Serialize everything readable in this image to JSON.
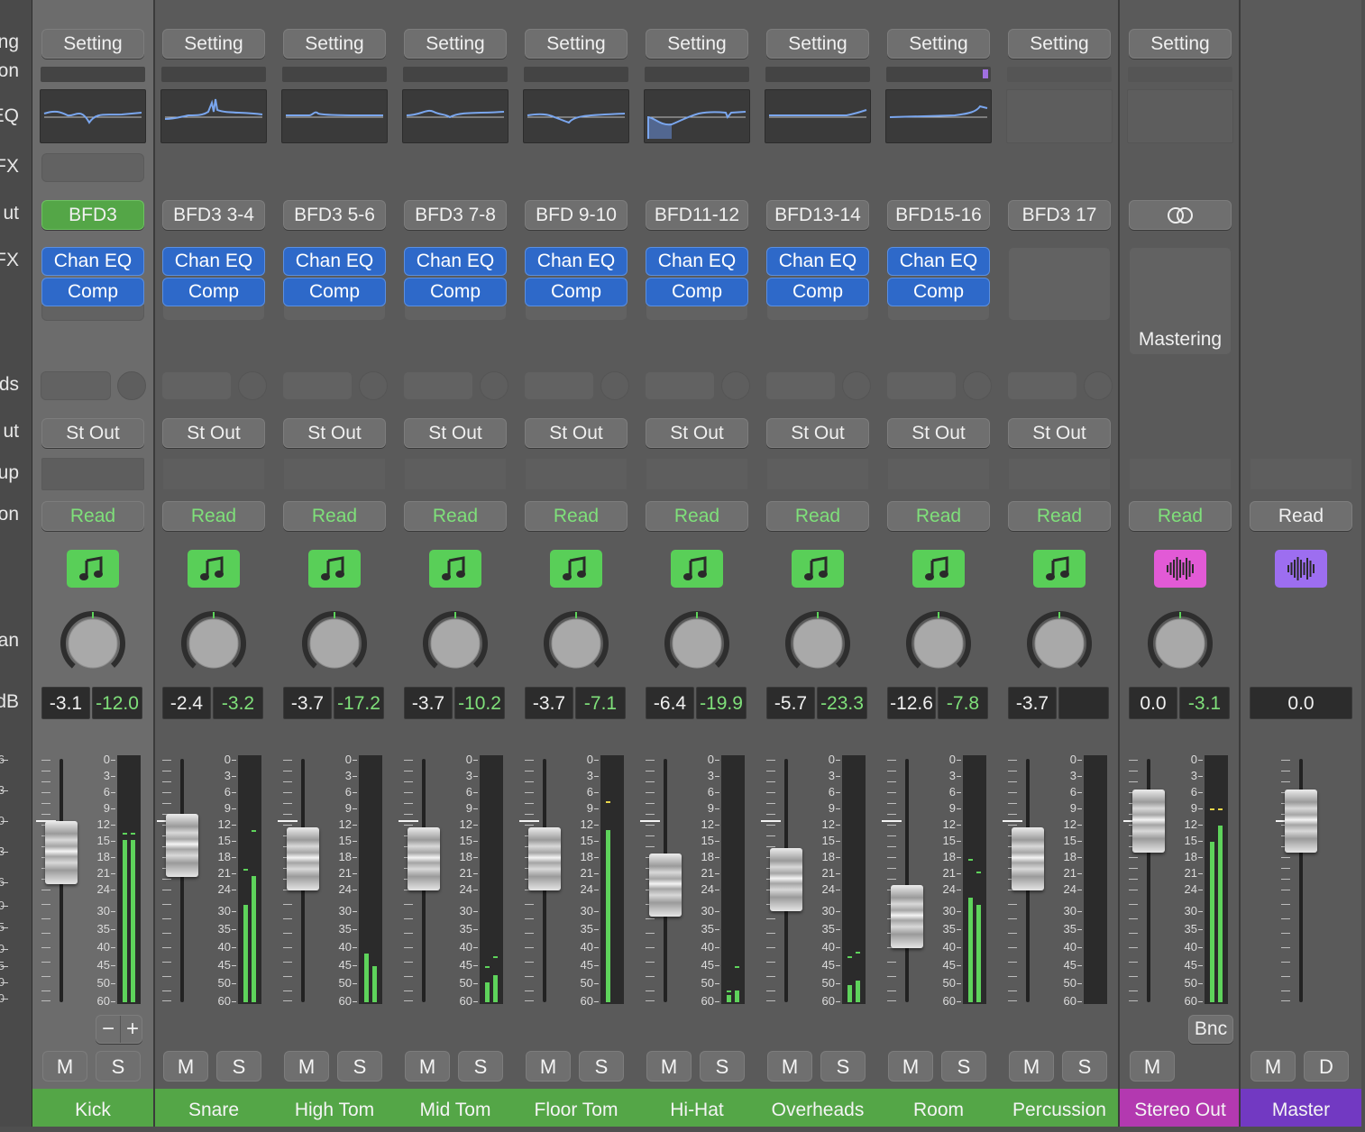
{
  "row_labels": [
    "ng",
    "on",
    "EQ",
    "FX",
    "ut",
    "FX",
    "ds",
    "ut",
    "up",
    "on",
    "an",
    "dB"
  ],
  "left_scale": [
    "6",
    "3",
    "0",
    "3",
    "6",
    "0",
    "5",
    "0",
    "5",
    "0",
    "0"
  ],
  "meter_scale": [
    "0",
    "3",
    "6",
    "9",
    "12",
    "15",
    "18",
    "21",
    "24",
    "30",
    "35",
    "40",
    "45",
    "50",
    "60"
  ],
  "colors": {
    "track_green": "#54a647",
    "stereo_magenta": "#b339b0",
    "master_purple": "#7239c2",
    "plugin_blue": "#2e69c9",
    "meter_green": "#5ed35b",
    "peak_yellow": "#e8d64a"
  },
  "channels": [
    {
      "name": "Kick",
      "setting": "Setting",
      "input": "BFD3",
      "input_active": true,
      "plugins": [
        "Chan EQ",
        "Comp"
      ],
      "output": "St Out",
      "automation": "Read",
      "icon": "music-note-icon",
      "volume": "-3.1",
      "peak": "-12.0",
      "fader_db": -3.1,
      "meter": [
        0.67,
        0.67
      ],
      "meter_peak": [
        0.7,
        0.7
      ],
      "selected": true,
      "mute": "M",
      "solo": "S",
      "ranking": "−",
      "add": "+"
    },
    {
      "name": "Snare",
      "setting": "Setting",
      "input": "BFD3 3-4",
      "plugins": [
        "Chan EQ",
        "Comp"
      ],
      "output": "St Out",
      "automation": "Read",
      "icon": "music-note-icon",
      "volume": "-2.4",
      "peak": "-3.2",
      "fader_db": -2.4,
      "meter": [
        0.4,
        0.52
      ],
      "meter_peak": [
        0.55,
        0.71
      ],
      "mute": "M",
      "solo": "S"
    },
    {
      "name": "High Tom",
      "setting": "Setting",
      "input": "BFD3 5-6",
      "plugins": [
        "Chan EQ",
        "Comp"
      ],
      "output": "St Out",
      "automation": "Read",
      "icon": "music-note-icon",
      "volume": "-3.7",
      "peak": "-17.2",
      "fader_db": -3.7,
      "meter": [
        0.2,
        0.15
      ],
      "mute": "M",
      "solo": "S"
    },
    {
      "name": "Mid Tom",
      "setting": "Setting",
      "input": "BFD3 7-8",
      "plugins": [
        "Chan EQ",
        "Comp"
      ],
      "output": "St Out",
      "automation": "Read",
      "icon": "music-note-icon",
      "volume": "-3.7",
      "peak": "-10.2",
      "fader_db": -3.7,
      "meter": [
        0.08,
        0.11
      ],
      "meter_peak": [
        0.15,
        0.19
      ],
      "mute": "M",
      "solo": "S"
    },
    {
      "name": "Floor Tom",
      "setting": "Setting",
      "input": "BFD 9-10",
      "plugins": [
        "Chan EQ",
        "Comp"
      ],
      "output": "St Out",
      "automation": "Read",
      "icon": "music-note-icon",
      "volume": "-3.7",
      "peak": "-7.1",
      "fader_db": -3.7,
      "meter": [
        0.71,
        0
      ],
      "meter_peak": [
        0.83,
        0
      ],
      "mute": "M",
      "solo": "S"
    },
    {
      "name": "Hi-Hat",
      "setting": "Setting",
      "input": "BFD11-12",
      "plugins": [
        "Chan EQ",
        "Comp"
      ],
      "output": "St Out",
      "automation": "Read",
      "icon": "music-note-icon",
      "volume": "-6.4",
      "peak": "-19.9",
      "fader_db": -6.4,
      "meter": [
        0.03,
        0.05
      ],
      "meter_peak": [
        0.05,
        0.15
      ],
      "mute": "M",
      "solo": "S"
    },
    {
      "name": "Overheads",
      "setting": "Setting",
      "input": "BFD13-14",
      "plugins": [
        "Chan EQ",
        "Comp"
      ],
      "output": "St Out",
      "automation": "Read",
      "icon": "music-note-icon",
      "volume": "-5.7",
      "peak": "-23.3",
      "fader_db": -5.7,
      "meter": [
        0.07,
        0.09
      ],
      "meter_peak": [
        0.19,
        0.21
      ],
      "mute": "M",
      "solo": "S"
    },
    {
      "name": "Room",
      "setting": "Setting",
      "input": "BFD15-16",
      "plugins": [
        "Chan EQ",
        "Comp"
      ],
      "output": "St Out",
      "automation": "Read",
      "icon": "music-note-icon",
      "volume": "-12.6",
      "peak": "-7.8",
      "fader_db": -12.6,
      "meter": [
        0.43,
        0.4
      ],
      "meter_peak": [
        0.59,
        0.54
      ],
      "mute": "M",
      "solo": "S"
    },
    {
      "name": "Percussion",
      "setting": "Setting",
      "input": "BFD3 17",
      "plugins": [],
      "output": "St Out",
      "automation": "Read",
      "icon": "music-note-icon",
      "volume": "-3.7",
      "peak": "",
      "fader_db": -3.7,
      "meter": [
        0,
        0
      ],
      "mute": "M",
      "solo": "S"
    },
    {
      "name": "Stereo Out",
      "setting": "Setting",
      "input": "",
      "input_icon": "stereo-link-icon",
      "plugins": [],
      "mastering": "Mastering",
      "output": "",
      "automation": "Read",
      "icon": "waveform-icon",
      "volume": "0.0",
      "peak": "-3.1",
      "fader_db": 0.0,
      "meter": [
        0.66,
        0.73
      ],
      "meter_peak": [
        0.8,
        0.8
      ],
      "mute": "M",
      "bounce": "Bnc"
    },
    {
      "name": "Master",
      "automation": "Read",
      "icon": "waveform-icon",
      "volume": "0.0",
      "fader_db": 0.0,
      "mute": "M",
      "dim": "D"
    }
  ]
}
